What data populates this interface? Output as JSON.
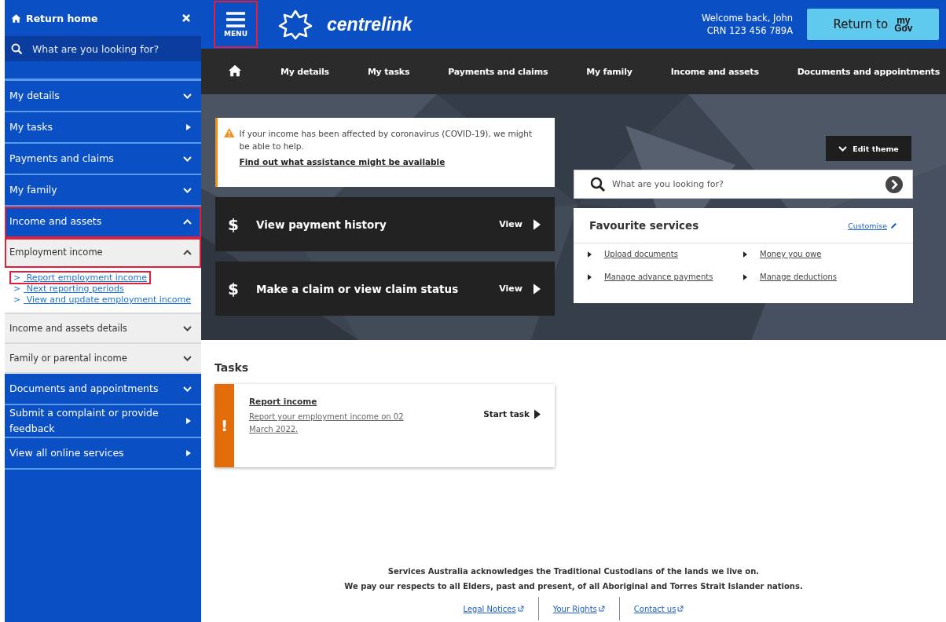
{
  "sidebar": {
    "return_home": "Return home",
    "search": {
      "placeholder": "What are you looking for?"
    },
    "items": [
      {
        "label": "My details",
        "kind": "expandable",
        "expanded": false,
        "highlighted": false
      },
      {
        "label": "My tasks",
        "kind": "link",
        "highlighted": false
      },
      {
        "label": "Payments and claims",
        "kind": "expandable",
        "expanded": false,
        "highlighted": false
      },
      {
        "label": "My family",
        "kind": "expandable",
        "expanded": false,
        "highlighted": false
      },
      {
        "label": "Income and assets",
        "kind": "expandable",
        "expanded": true,
        "highlighted": true,
        "children": [
          {
            "label": "Employment income",
            "kind": "expandable",
            "expanded": true,
            "highlighted": true,
            "links": [
              {
                "marker": ">",
                "label": "Report employment income",
                "highlighted": true
              },
              {
                "marker": ">",
                "label": "Next reporting periods",
                "highlighted": false
              },
              {
                "marker": ">",
                "label": "View and update employment income",
                "highlighted": false
              }
            ]
          },
          {
            "label": "Income and assets details",
            "kind": "expandable",
            "expanded": false,
            "highlighted": false
          },
          {
            "label": "Family or parental income",
            "kind": "expandable",
            "expanded": false,
            "highlighted": false
          }
        ]
      },
      {
        "label": "Documents and appointments",
        "kind": "expandable",
        "expanded": false,
        "highlighted": false
      },
      {
        "label": "Submit a complaint or provide feedback",
        "kind": "link",
        "highlighted": false
      },
      {
        "label": "View all online services",
        "kind": "link",
        "highlighted": false
      }
    ]
  },
  "header": {
    "menu_button": {
      "label": "MENU",
      "highlighted": true
    },
    "brand": "centrelink",
    "welcome": "Welcome back, John",
    "crn": "CRN 123 456 789A",
    "return_button": {
      "label": "Return to",
      "logo_top": "my",
      "logo_bottom": "Gov"
    }
  },
  "nav": {
    "items": [
      "My details",
      "My tasks",
      "Payments and claims",
      "My family",
      "Income and assets",
      "Documents and appointments"
    ]
  },
  "hero": {
    "alert": {
      "text": "If your income has been affected by coronavirus (COVID-19), we might be able to help.",
      "link": "Find out what assistance might be available"
    },
    "action_cards": [
      {
        "symbol": "$",
        "title": "View payment history",
        "action": "View"
      },
      {
        "symbol": "$",
        "title": "Make a claim or view claim status",
        "action": "View"
      }
    ],
    "edit_theme": "Edit theme",
    "search": {
      "placeholder": "What are you looking for?"
    },
    "favourites": {
      "title": "Favourite services",
      "customise": "Customise",
      "links": [
        "Upload documents",
        "Money you owe",
        "Manage advance payments",
        "Manage deductions"
      ]
    }
  },
  "tasks": {
    "title": "Tasks",
    "items": [
      {
        "marker": "!",
        "title": "Report income",
        "description": "Report your employment income on 02 March 2022.",
        "action": "Start task"
      }
    ]
  },
  "footer": {
    "lines": [
      "Services Australia acknowledges the Traditional Custodians of the lands we live on.",
      "We pay our respects to all Elders, past and present, of all Aboriginal and Torres Strait Islander nations."
    ],
    "links": [
      "Legal Notices",
      "Your Rights",
      "Contact us"
    ]
  }
}
